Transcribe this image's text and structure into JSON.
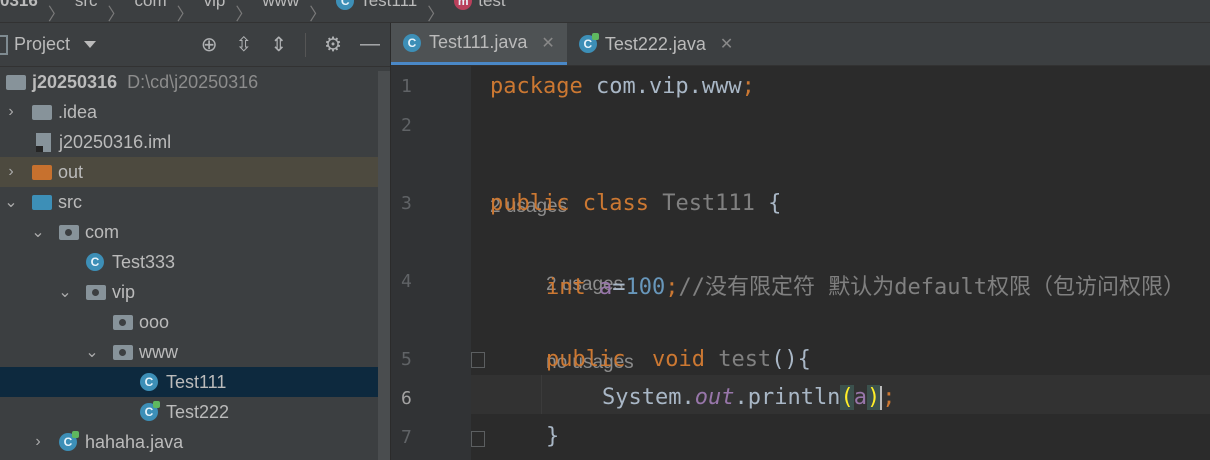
{
  "breadcrumb": {
    "items": [
      "0316",
      "src",
      "com",
      "vip",
      "www",
      "Test111",
      "test"
    ]
  },
  "project_panel": {
    "title": "Project",
    "root": {
      "name": "j20250316",
      "path": "D:\\cd\\j20250316"
    },
    "items": [
      {
        "label": ".idea",
        "type": "folder"
      },
      {
        "label": "j20250316.iml",
        "type": "file"
      },
      {
        "label": "out",
        "type": "folder-orange"
      },
      {
        "label": "src",
        "type": "folder-blue"
      },
      {
        "label": "com",
        "type": "package"
      },
      {
        "label": "Test333",
        "type": "class"
      },
      {
        "label": "vip",
        "type": "package"
      },
      {
        "label": "ooo",
        "type": "package"
      },
      {
        "label": "www",
        "type": "package"
      },
      {
        "label": "Test111",
        "type": "class"
      },
      {
        "label": "Test222",
        "type": "class-runnable"
      },
      {
        "label": "hahaha.java",
        "type": "class-runnable"
      }
    ]
  },
  "tabs": [
    {
      "label": "Test111.java",
      "active": true
    },
    {
      "label": "Test222.java",
      "active": false
    }
  ],
  "editor": {
    "line_numbers": [
      "1",
      "2",
      "3",
      "4",
      "5",
      "6",
      "7"
    ],
    "hints": [
      "2 usages",
      "2 usages",
      "no usages"
    ],
    "code": {
      "l1_kw": "package",
      "l1_rest": " com.vip.www",
      "l1_semi": ";",
      "l3_kw": "public class",
      "l3_name": " Test111 ",
      "l3_brace": "{",
      "l4_kw": "int",
      "l4_field": " a",
      "l4_eq": "=",
      "l4_num": "100",
      "l4_semi": ";",
      "l4_comment": "//没有限定符 默认为default权限（包访问权限）",
      "l5_kw": "public  void",
      "l5_name": " test",
      "l5_paren": "(){",
      "l6_sys": "System.",
      "l6_out": "out",
      "l6_print": ".println",
      "l6_open": "(",
      "l6_arg": "a",
      "l6_close": ")",
      "l6_semi": ";",
      "l7_brace": "}"
    }
  }
}
